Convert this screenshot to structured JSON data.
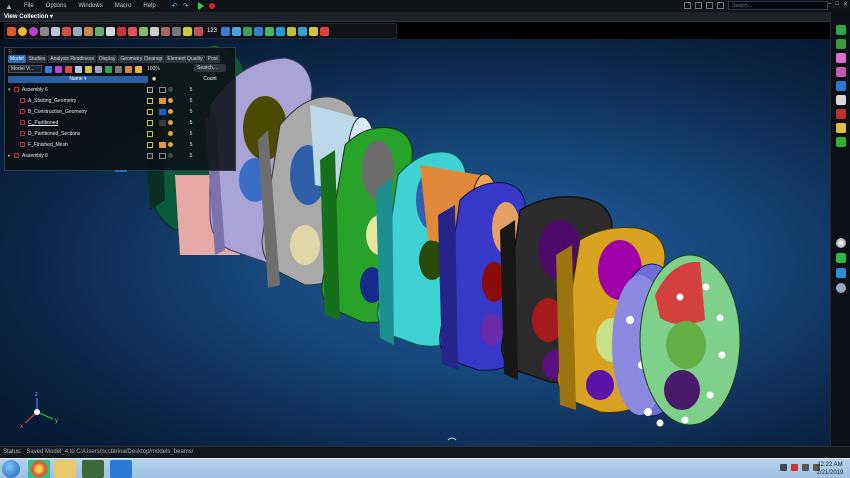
{
  "menu": {
    "file": "File",
    "options": "Options",
    "windows": "Windows",
    "macro": "Macro",
    "help": "Help"
  },
  "search": {
    "placeholder": "Search..."
  },
  "view_collection": {
    "label": "View Collection ▾"
  },
  "toolbar": {
    "count": "123"
  },
  "panel": {
    "tabs": [
      "Model",
      "Studies",
      "Analysis Readiness",
      "Display",
      "Geometry Cleanup",
      "Element Quality",
      "Post"
    ],
    "view_select": "Model Vi...",
    "zoom": "100%",
    "search_label": "Search...",
    "columns": {
      "name": "Name ▾",
      "count": "Count"
    },
    "rows": [
      {
        "arrow": "▾",
        "name": "Assembly 6",
        "count": "5"
      },
      {
        "arrow": "",
        "name": "A_Starting_Geometry",
        "count": "5"
      },
      {
        "arrow": "",
        "name": "B_Construction_Geometry",
        "count": "5"
      },
      {
        "arrow": "",
        "name": "C_Partitioned",
        "count": "5"
      },
      {
        "arrow": "",
        "name": "D_Partitioned_Sections",
        "count": "5"
      },
      {
        "arrow": "",
        "name": "F_Finished_Mesh",
        "count": "5"
      },
      {
        "arrow": "▸",
        "name": "Assembly 8",
        "count": "5"
      }
    ]
  },
  "axes": {
    "x": "x",
    "y": "y",
    "z": "z"
  },
  "status": {
    "label": "Status:",
    "message": "Saved Model_4 to C:/Users/ncstarina/Desktop/models_beams/"
  },
  "clock": {
    "time": "12:22 AM",
    "date": "2/21/2019"
  },
  "colors": {
    "accent": "#2a6fb5",
    "viewport_bg": "#17467a",
    "status_bg": "#13171c"
  }
}
